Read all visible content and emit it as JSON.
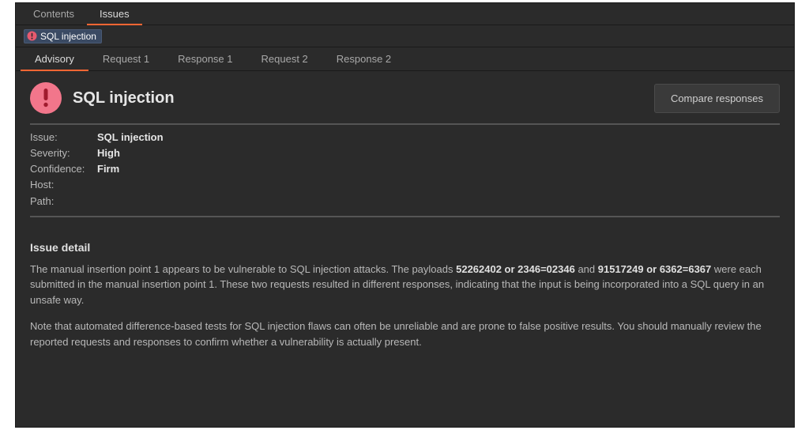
{
  "topTabs": {
    "contents": "Contents",
    "issues": "Issues"
  },
  "issueChip": {
    "label": "SQL injection"
  },
  "subTabs": {
    "advisory": "Advisory",
    "request1": "Request 1",
    "response1": "Response 1",
    "request2": "Request 2",
    "response2": "Response 2"
  },
  "header": {
    "title": "SQL injection",
    "compareBtn": "Compare responses"
  },
  "meta": {
    "issueLabel": "Issue:",
    "issueValue": "SQL injection",
    "severityLabel": "Severity:",
    "severityValue": "High",
    "confidenceLabel": "Confidence:",
    "confidenceValue": "Firm",
    "hostLabel": "Host:",
    "hostValue": "",
    "pathLabel": "Path:",
    "pathValue": ""
  },
  "detail": {
    "heading": "Issue detail",
    "p1_a": "The manual insertion point 1 appears to be vulnerable to SQL injection attacks. The payloads ",
    "p1_b1": "52262402 or 2346=02346",
    "p1_c": " and ",
    "p1_b2": "91517249 or 6362=6367",
    "p1_d": " were each submitted in the manual insertion point 1. These two requests resulted in different responses, indicating that the input is being incorporated into a SQL query in an unsafe way.",
    "p2": "Note that automated difference-based tests for SQL injection flaws can often be unreliable and are prone to false positive results. You should manually review the reported requests and responses to confirm whether a vulnerability is actually present."
  }
}
